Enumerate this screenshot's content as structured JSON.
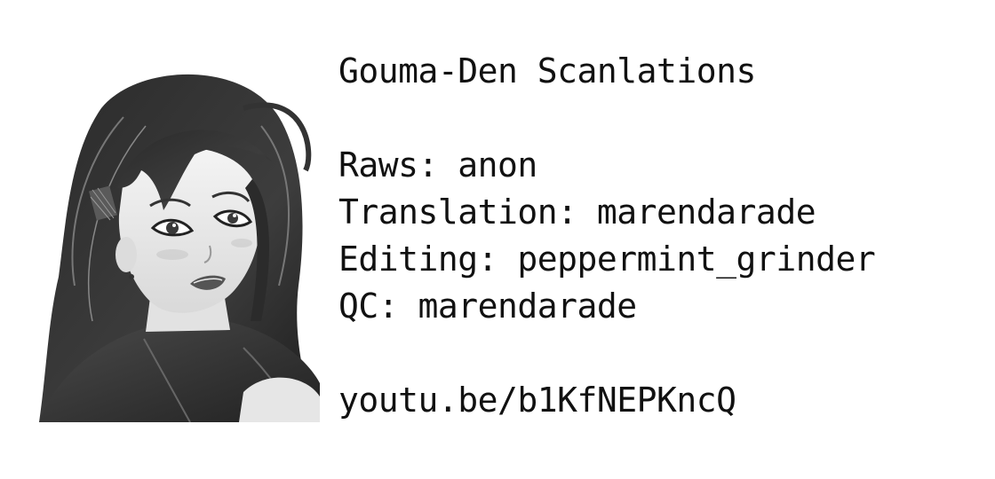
{
  "group_name": "Gouma-Den Scanlations",
  "credits": [
    {
      "text": "Raws: anon"
    },
    {
      "text": "Translation: marendarade"
    },
    {
      "text": "Editing: peppermint_grinder"
    },
    {
      "text": "QC: marendarade"
    }
  ],
  "link": "youtu.be/b1KfNEPKncQ",
  "illustration": {
    "subject": "manga-style woman portrait",
    "palette": "grayscale"
  }
}
